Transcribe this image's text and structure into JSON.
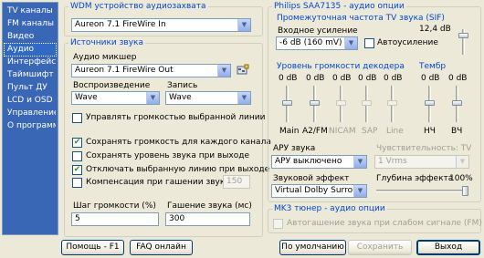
{
  "sidebar": {
    "items": [
      {
        "label": "TV каналы"
      },
      {
        "label": "FM каналы"
      },
      {
        "label": "Видео"
      },
      {
        "label": "Аудио",
        "active": true
      },
      {
        "label": "Интерфейс"
      },
      {
        "label": "Таймшифт"
      },
      {
        "label": "Пульт ДУ"
      },
      {
        "label": "LCD и OSD"
      },
      {
        "label": "Управление"
      },
      {
        "label": "О программе"
      }
    ]
  },
  "wdm": {
    "title": "WDM устройство аудиозахвата",
    "device": "Aureon 7.1 FireWire In"
  },
  "source": {
    "title": "Источники звука",
    "mixer_label": "Аудио микшер",
    "mixer_value": "Aureon 7.1 FireWire Out",
    "playback_label": "Воспроизведение",
    "playback_value": "Wave",
    "record_label": "Запись",
    "record_value": "Wave",
    "control_line_label": "Управлять громкостью выбранной линии",
    "save_volume_label": "Сохранять громкость для каждого канала",
    "save_level_label": "Сохранять уровень звука при выходе",
    "disable_line_label": "Отключать выбранную линию при выходе",
    "compensation_label": "Компенсация при гашении звука (мс)",
    "compensation_value": "150",
    "volume_step_label": "Шаг громкости (%)",
    "volume_step_value": "5",
    "fade_label": "Гашение звука (мс)",
    "fade_value": "300"
  },
  "philips": {
    "title": "Philips SAA7135 - аудио опции",
    "sif_title": "Промежуточная частота TV звука (SIF)",
    "input_gain_label": "Входное усиление",
    "input_gain_value": "-6 dB (160 mV)",
    "auto_gain_label": "Автоусиление",
    "db_readout": "12,4 dB",
    "decoder_title": "Уровень громкости декодера",
    "timbre_title": "Тембр",
    "sliders": [
      {
        "value": "0 dB",
        "label": "Main"
      },
      {
        "value": "0 dB",
        "label": "A2/FM"
      },
      {
        "value": "0 dB",
        "label": "NICAM"
      },
      {
        "value": "0 dB",
        "label": "SAP"
      },
      {
        "value": "0 dB",
        "label": "Line"
      }
    ],
    "timbre_sliders": [
      {
        "value": "0 dB",
        "label": "НЧ"
      },
      {
        "value": "0 dB",
        "label": "ВЧ"
      }
    ],
    "aru_label": "АРУ звука",
    "aru_value": "АРУ выключено",
    "sensitivity_label": "Чувствительность: TV",
    "sensitivity_value": "1 Vrms",
    "effect_label": "Звуковой эффект",
    "effect_value": "Virtual Dolby Surround",
    "depth_label": "Глубина эффекта",
    "depth_value": "100%"
  },
  "mk3": {
    "title": "MK3 тюнер - аудио опции",
    "auto_gain_label": "Автогашение звука при слабом сигнале (FM)"
  },
  "buttons": {
    "help": "Помощь - F1",
    "faq": "FAQ онлайн",
    "default": "По умолчанию",
    "save": "Сохранить",
    "exit": "Выход"
  }
}
